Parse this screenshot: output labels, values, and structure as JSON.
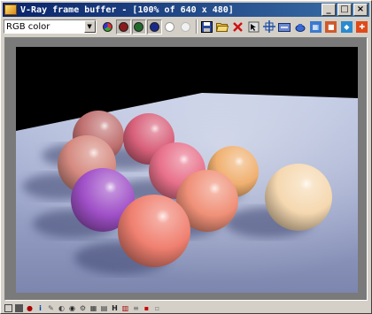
{
  "window": {
    "title": "V-Ray frame buffer - [100% of 640 x 480]"
  },
  "title_buttons": {
    "minimize": "_",
    "maximize": "□",
    "close": "×"
  },
  "toolbar": {
    "channel_value": "RGB color",
    "channel_buttons": [
      {
        "name": "red-channel-button",
        "color": "#8b1a1a"
      },
      {
        "name": "green-channel-button",
        "color": "#1f6b2a"
      },
      {
        "name": "blue-channel-button",
        "color": "#1a2a8b"
      },
      {
        "name": "alpha-channel-button",
        "color": "#ffffff"
      },
      {
        "name": "mono-channel-button",
        "color": "#f0f0f0"
      }
    ]
  },
  "render": {
    "background": "#000000",
    "floor_color": "#9aa4c8",
    "spheres": [
      {
        "name": "sphere-rose",
        "color": "#c07070"
      },
      {
        "name": "sphere-raspberry",
        "color": "#d8607a"
      },
      {
        "name": "sphere-salmon-back",
        "color": "#d58a80"
      },
      {
        "name": "sphere-pink",
        "color": "#e8708a"
      },
      {
        "name": "sphere-peach",
        "color": "#f0b070"
      },
      {
        "name": "sphere-violet",
        "color": "#a050c8"
      },
      {
        "name": "sphere-coral",
        "color": "#f09078"
      },
      {
        "name": "sphere-cream",
        "color": "#f5d8b0"
      },
      {
        "name": "sphere-salmon-front",
        "color": "#f08070"
      }
    ]
  }
}
